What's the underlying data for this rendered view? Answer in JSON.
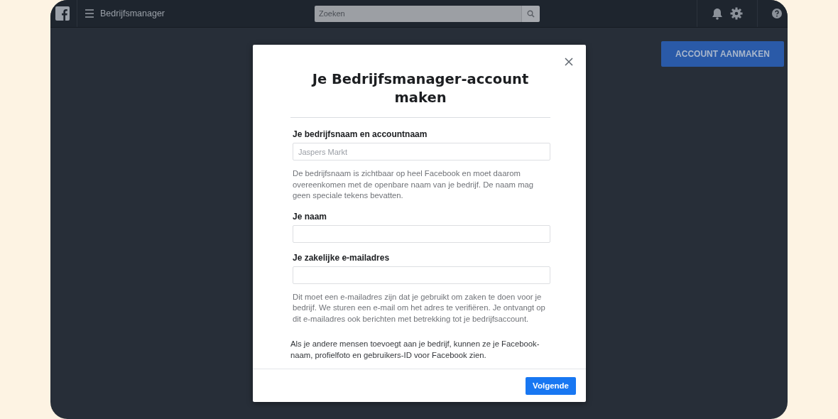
{
  "top_bar": {
    "title": "Bedrijfsmanager",
    "search": {
      "placeholder": "Zoeken"
    }
  },
  "create_account_button": "ACCOUNT AANMAKEN",
  "dialog": {
    "title": "Je Bedrijfsmanager-account maken",
    "fields": [
      {
        "label": "Je bedrijfsnaam en accountnaam",
        "placeholder": "Jaspers Markt",
        "help": "De bedrijfsnaam is zichtbaar op heel Facebook en moet daarom overeenkomen met de openbare naam van je bedrijf. De naam mag geen speciale tekens bevatten."
      },
      {
        "label": "Je naam"
      },
      {
        "label": "Je zakelijke e-mailadres",
        "help": "Dit moet een e-mailadres zijn dat je gebruikt om zaken te doen voor je bedrijf. We sturen een e-mail om het adres te verifiëren. Je ontvangt op dit e-mailadres ook berichten met betrekking tot je bedrijfsaccount."
      }
    ],
    "note": "Als je andere mensen toevoegt aan je bedrijf, kunnen ze je Facebook-naam, profielfoto en gebruikers-ID voor Facebook zien.",
    "next_button": "Volgende"
  }
}
